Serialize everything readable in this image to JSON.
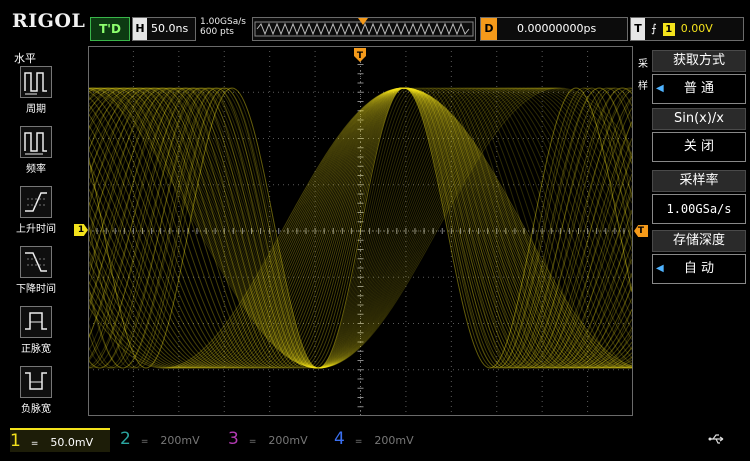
{
  "header": {
    "brand": "RIGOL",
    "run_state": "T'D",
    "horizontal": {
      "tag": "H",
      "value": "50.0ns"
    },
    "sample_info": {
      "rate": "1.00GSa/s",
      "points": "600 pts"
    },
    "delay": {
      "tag": "D",
      "value": "0.00000000ps"
    },
    "trigger": {
      "tag": "T",
      "channel": "1",
      "level": "0.00V",
      "edge_icon": "rising-edge-icon"
    }
  },
  "left_menu": {
    "title": "水平",
    "items": [
      {
        "label": "周期",
        "icon": "period-icon"
      },
      {
        "label": "频率",
        "icon": "frequency-icon"
      },
      {
        "label": "上升时间",
        "icon": "rise-time-icon"
      },
      {
        "label": "下降时间",
        "icon": "fall-time-icon"
      },
      {
        "label": "正脉宽",
        "icon": "positive-width-icon"
      },
      {
        "label": "负脉宽",
        "icon": "negative-width-icon"
      }
    ]
  },
  "right_menu": {
    "title": "采样",
    "groups": [
      {
        "header": "获取方式",
        "value": "普 通"
      },
      {
        "header": "Sin(x)/x",
        "value": "关 闭"
      },
      {
        "header": "采样率",
        "value": "1.00GSa/s"
      },
      {
        "header": "存储深度",
        "value": "自 动"
      }
    ]
  },
  "markers": {
    "ch1_marker": "1",
    "trigger_marker": "T"
  },
  "channels": [
    {
      "num": "1",
      "coupling": "=",
      "scale": "50.0mV"
    },
    {
      "num": "2",
      "coupling": "=",
      "scale": "200mV"
    },
    {
      "num": "3",
      "coupling": "=",
      "scale": "200mV"
    },
    {
      "num": "4",
      "coupling": "=",
      "scale": "200mV"
    }
  ],
  "colors": {
    "ch1": "#f3e21c",
    "ch2": "#2aa5a0",
    "ch3": "#b23ab2",
    "ch4": "#3a6ff0",
    "delay": "#f59a1a",
    "run": "#39b54a"
  }
}
